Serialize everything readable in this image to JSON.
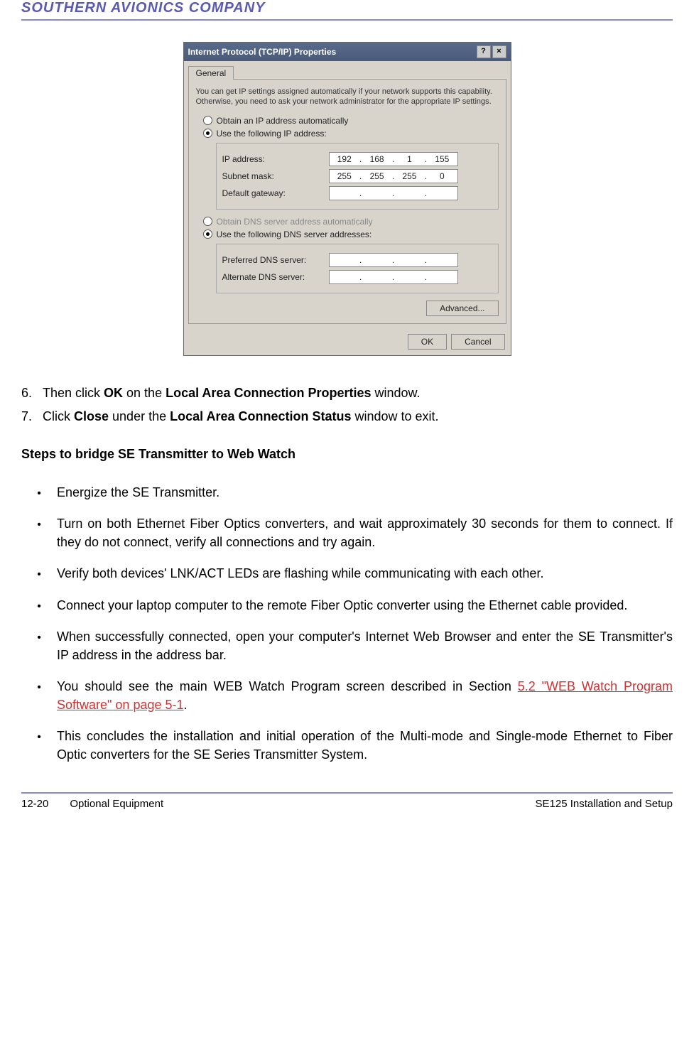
{
  "header": {
    "company": "SOUTHERN AVIONICS COMPANY"
  },
  "dialog": {
    "title": "Internet Protocol (TCP/IP) Properties",
    "tab": "General",
    "description": "You can get IP settings assigned automatically if your network supports this capability. Otherwise, you need to ask your network administrator for the appropriate IP settings.",
    "radio_auto_ip": "Obtain an IP address automatically",
    "radio_manual_ip": "Use the following IP address:",
    "ip_label": "IP address:",
    "ip_value": [
      "192",
      "168",
      "1",
      "155"
    ],
    "subnet_label": "Subnet mask:",
    "subnet_value": [
      "255",
      "255",
      "255",
      "0"
    ],
    "gateway_label": "Default gateway:",
    "gateway_value": [
      "",
      "",
      "",
      ""
    ],
    "radio_auto_dns": "Obtain DNS server address automatically",
    "radio_manual_dns": "Use the following DNS server addresses:",
    "pref_dns_label": "Preferred DNS server:",
    "alt_dns_label": "Alternate DNS server:",
    "advanced_btn": "Advanced...",
    "ok_btn": "OK",
    "cancel_btn": "Cancel"
  },
  "steps": [
    {
      "num": "6.",
      "pre": "Then click ",
      "b1": "OK",
      "mid": " on the ",
      "b2": "Local Area Connection Properties",
      "post": " window."
    },
    {
      "num": "7.",
      "pre": "Click ",
      "b1": "Close",
      "mid": " under the ",
      "b2": "Local Area Connection Status",
      "post": " window to exit."
    }
  ],
  "section_title": "Steps to bridge SE Transmitter to Web Watch",
  "bullets": [
    {
      "text": "Energize the SE Transmitter."
    },
    {
      "text": "Turn on both Ethernet Fiber Optics converters, and wait approximately 30 seconds for them to connect.  If they do not connect, verify all connections and try again."
    },
    {
      "text": "Verify both devices' LNK/ACT LEDs are flashing while communicating with each other."
    },
    {
      "text": "Connect your laptop computer to the remote Fiber Optic converter using the Ethernet cable provided."
    },
    {
      "text": "When successfully connected, open your computer's Internet Web Browser and enter the SE Transmitter's IP address in the address bar."
    },
    {
      "pre": "You should see the main WEB Watch Program screen described in Section ",
      "link": "5.2 \"WEB Watch Program Software\" on page 5-1",
      "post": "."
    },
    {
      "text": "This concludes the installation and initial operation of the Multi-mode and Single-mode Ethernet to Fiber Optic converters for the SE Series Transmitter System."
    }
  ],
  "footer": {
    "page": "12-20",
    "section": "Optional Equipment",
    "doc": "SE125 Installation and Setup"
  }
}
